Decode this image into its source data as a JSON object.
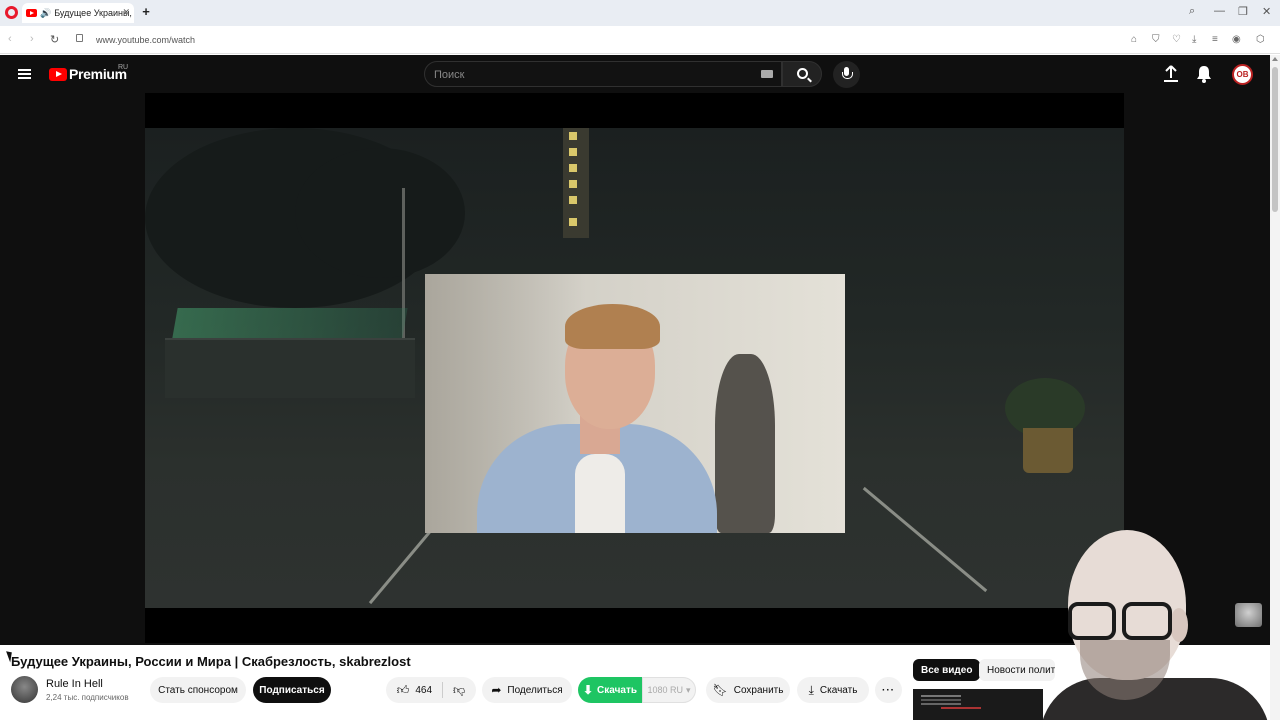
{
  "browser": {
    "tab_title": "Будущее Украины, Р",
    "url": "www.youtube.com/watch"
  },
  "youtube": {
    "logo_text": "Premium",
    "logo_region": "RU",
    "search_placeholder": "Поиск",
    "avatar_initials": "ОВ"
  },
  "video": {
    "title": "Будущее Украины, России и Мира | Скабрезлость, skabrezlost"
  },
  "channel": {
    "name": "Rule In Hell",
    "subscribers": "2,24 тыс. подписчиков",
    "sponsor_label": "Стать спонсором",
    "subscribe_label": "Подписаться"
  },
  "actions": {
    "likes": "464",
    "share_label": "Поделиться",
    "download_ext_label": "Скачать",
    "quality_label": "1080 RU",
    "save_label": "Сохранить",
    "download_label": "Скачать"
  },
  "recommendations": {
    "chips": [
      "Все видео",
      "Новости полит"
    ]
  },
  "colors": {
    "youtube_red": "#ff0000",
    "download_green": "#1ec563",
    "page_dark": "#0f0f0f"
  }
}
